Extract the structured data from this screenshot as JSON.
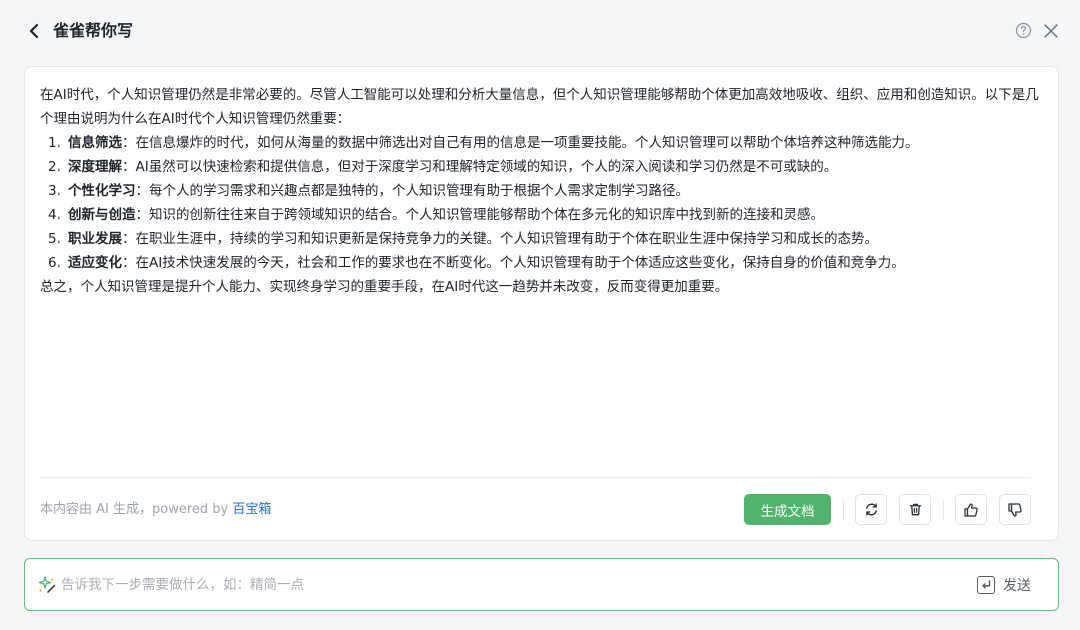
{
  "header": {
    "title": "雀雀帮你写",
    "icons": {
      "back": "chevron-left-icon",
      "help": "question-circle-icon",
      "close": "close-icon"
    }
  },
  "content": {
    "intro": "在AI时代，个人知识管理仍然是非常必要的。尽管人工智能可以处理和分析大量信息，但个人知识管理能够帮助个体更加高效地吸收、组织、应用和创造知识。以下是几个理由说明为什么在AI时代个人知识管理仍然重要：",
    "items": [
      {
        "num": "1.",
        "title": "信息筛选",
        "text": "：在信息爆炸的时代，如何从海量的数据中筛选出对自己有用的信息是一项重要技能。个人知识管理可以帮助个体培养这种筛选能力。"
      },
      {
        "num": "2.",
        "title": "深度理解",
        "text": "：AI虽然可以快速检索和提供信息，但对于深度学习和理解特定领域的知识，个人的深入阅读和学习仍然是不可或缺的。"
      },
      {
        "num": "3.",
        "title": "个性化学习",
        "text": "：每个人的学习需求和兴趣点都是独特的，个人知识管理有助于根据个人需求定制学习路径。"
      },
      {
        "num": "4.",
        "title": "创新与创造",
        "text": "：知识的创新往往来自于跨领域知识的结合。个人知识管理能够帮助个体在多元化的知识库中找到新的连接和灵感。"
      },
      {
        "num": "5.",
        "title": "职业发展",
        "text": "：在职业生涯中，持续的学习和知识更新是保持竞争力的关键。个人知识管理有助于个体在职业生涯中保持学习和成长的态势。"
      },
      {
        "num": "6.",
        "title": "适应变化",
        "text": "：在AI技术快速发展的今天，社会和工作的要求也在不断变化。个人知识管理有助于个体适应这些变化，保持自身的价值和竞争力。"
      }
    ],
    "conclusion": "总之，个人知识管理是提升个人能力、实现终身学习的重要手段，在AI时代这一趋势并未改变，反而变得更加重要。"
  },
  "footer": {
    "note_prefix": "本内容由 AI 生成，powered by ",
    "note_brand": "百宝箱",
    "generate_doc_label": "生成文档",
    "icons": {
      "regenerate": "refresh-icon",
      "delete": "trash-icon",
      "like": "thumbs-up-icon",
      "dislike": "thumbs-down-icon"
    },
    "colors": {
      "primary": "#52b46c",
      "brand_link": "#2b6cdc"
    }
  },
  "input": {
    "placeholder": "告诉我下一步需要做什么，如：精简一点",
    "value": "",
    "send_label": "发送",
    "icons": {
      "sparkle": "sparkle-pen-icon",
      "enter": "enter-key-icon"
    }
  }
}
